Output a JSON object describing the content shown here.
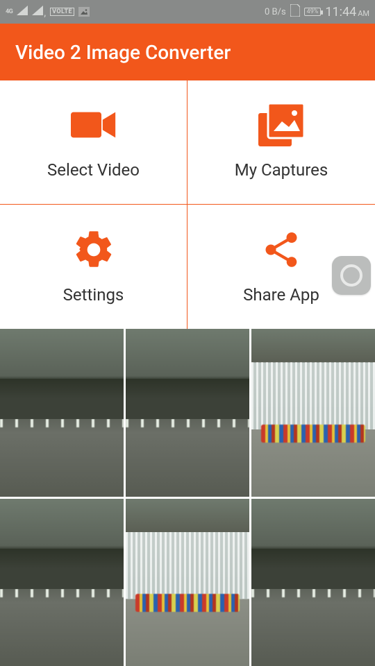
{
  "status": {
    "network_4g": "4G",
    "volte": "VOLTE",
    "speed": "0 B/s",
    "battery": "49%",
    "time": "11:44",
    "ampm": "AM"
  },
  "header": {
    "title": "Video 2 Image Converter"
  },
  "tiles": {
    "select_video": "Select Video",
    "my_captures": "My Captures",
    "settings": "Settings",
    "share_app": "Share App"
  },
  "accent": "#f2571b"
}
